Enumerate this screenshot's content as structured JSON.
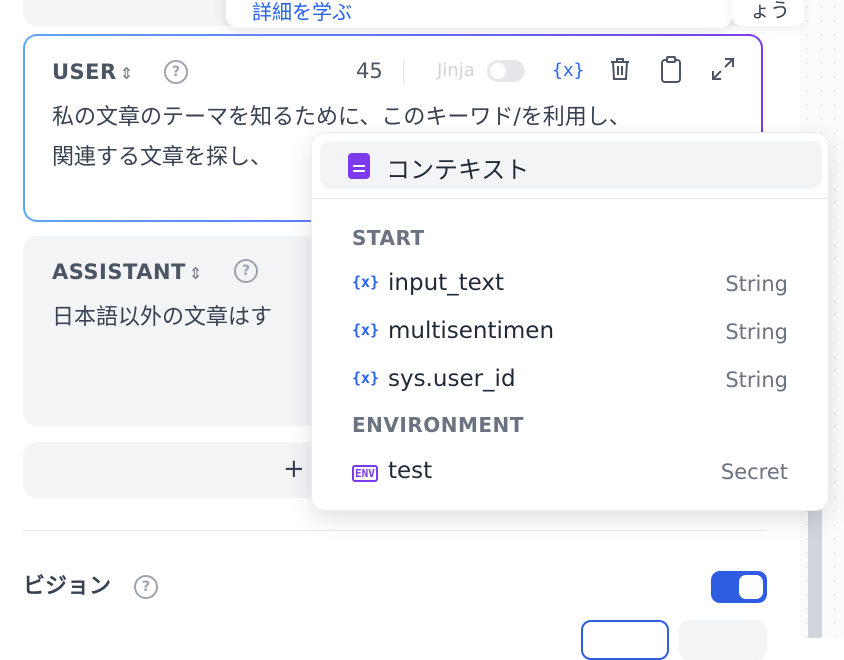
{
  "top_tooltip": {
    "link_text": "詳細を学ぶ",
    "right_text": "ょう"
  },
  "user_block": {
    "role": "USER",
    "sort_glyph": "⇕",
    "help_glyph": "?",
    "token_count": "45",
    "jinja_label": "Jinja",
    "tools": {
      "variable": "{x}",
      "delete": "🗑",
      "copy": "📋",
      "expand": "⤢"
    },
    "line1": "私の文章のテーマを知るために、このキーワド/を利用し、",
    "line2": "関連する文章を探し、"
  },
  "assistant_block": {
    "role": "ASSISTANT",
    "help_glyph": "?",
    "line1": "日本語以外の文章はす"
  },
  "add_bar": {
    "plus": "+"
  },
  "vision": {
    "label": "ビジョン",
    "help_glyph": "?",
    "enabled": true
  },
  "variable_menu": {
    "context_label": "コンテキスト",
    "groups": [
      {
        "title": "START",
        "items": [
          {
            "name": "input_text",
            "type": "String"
          },
          {
            "name": "multisentimen",
            "type": "String"
          },
          {
            "name": "sys.user_id",
            "type": "String"
          }
        ]
      },
      {
        "title": "ENVIRONMENT",
        "items": [
          {
            "name": "test",
            "type": "Secret"
          }
        ]
      }
    ],
    "var_icon": "{x}",
    "env_icon": "ENV"
  }
}
